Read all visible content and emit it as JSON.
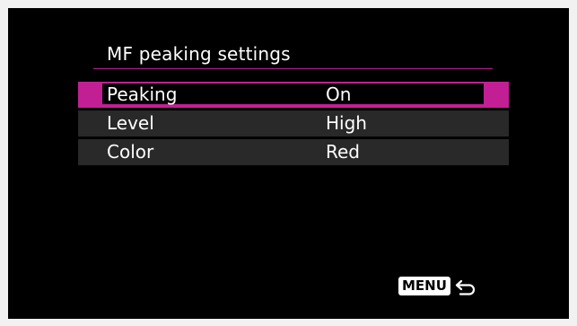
{
  "screen": {
    "title": "MF peaking settings",
    "accent_color": "#c21f95"
  },
  "items": [
    {
      "label": "Peaking",
      "value": "On",
      "selected": true
    },
    {
      "label": "Level",
      "value": "High",
      "selected": false
    },
    {
      "label": "Color",
      "value": "Red",
      "selected": false
    }
  ],
  "footer": {
    "menu_label": "MENU",
    "back_icon": "return-arrow-icon"
  }
}
